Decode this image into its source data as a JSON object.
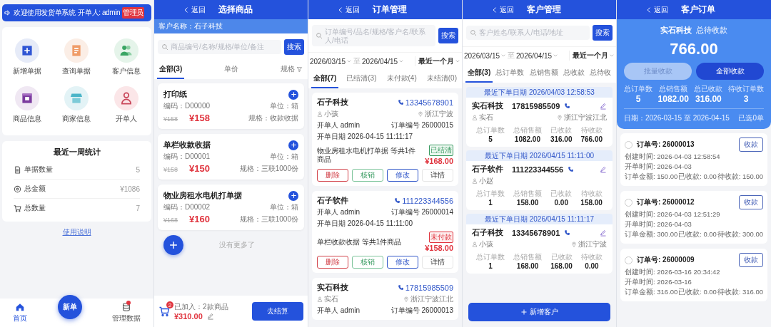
{
  "home": {
    "banner": {
      "text": "欢迎使用发货单系统",
      "operator": "开单人: admin",
      "role": "管理员"
    },
    "shortcuts": [
      {
        "kind": "add",
        "label": "新增单据"
      },
      {
        "kind": "query",
        "label": "查询单据"
      },
      {
        "kind": "customer",
        "label": "客户信息"
      },
      {
        "kind": "goods",
        "label": "商品信息"
      },
      {
        "kind": "merchant",
        "label": "商家信息"
      },
      {
        "kind": "operator",
        "label": "开单人"
      }
    ],
    "stats": {
      "title": "最近一周统计",
      "rows": [
        {
          "kind": "doc",
          "label": "单据数量",
          "value": "5"
        },
        {
          "kind": "coin",
          "label": "总金额",
          "value": "¥1086"
        },
        {
          "kind": "cart",
          "label": "总数量",
          "value": "7"
        }
      ]
    },
    "help_link": "使用说明",
    "tabbar": {
      "items": [
        {
          "kind": "home",
          "label": "首页",
          "selected": true,
          "badge": false
        },
        {
          "kind": "data",
          "label": "管理数据",
          "selected": false,
          "badge": true
        }
      ],
      "new_button": "新单"
    }
  },
  "select_goods": {
    "header": {
      "back": "返回",
      "title": "选择商品"
    },
    "customer": "客户名称：石子科技",
    "search": {
      "placeholder": "商品编号/名称/规格/单位/备注",
      "button": "搜索"
    },
    "tabs": [
      {
        "label": "全部(3)",
        "selected": true,
        "filter": false
      },
      {
        "label": "单价",
        "selected": false,
        "filter": false
      },
      {
        "label": "规格",
        "selected": false,
        "filter": true
      }
    ],
    "goods": [
      {
        "name": "打印纸",
        "code": "编码：D00000",
        "unit": "单位：箱",
        "old_price": "¥158",
        "price": "¥158",
        "spec": "规格：收款收据"
      },
      {
        "name": "单栏收款收据",
        "code": "编码：D00001",
        "unit": "单位：箱",
        "old_price": "¥158",
        "price": "¥150",
        "spec": "规格：三联1000份"
      },
      {
        "name": "物业房租水电机打单据",
        "code": "编码：D00002",
        "unit": "单位：箱",
        "old_price": "¥168",
        "price": "¥160",
        "spec": "规格：三联1000份"
      }
    ],
    "no_more": "没有更多了",
    "cart": {
      "count": "2",
      "added": "已加入：2款商品",
      "total": "¥310.00",
      "checkout": "去结算"
    }
  },
  "orders": {
    "header": {
      "back": "返回",
      "title": "订单管理"
    },
    "search": {
      "placeholder": "订单编号/品名/规格/客户名/联系人/电话",
      "button": "搜索"
    },
    "dates": {
      "from": "2026/03/15",
      "sep": "至",
      "to": "2026/04/15",
      "range": "最近一个月"
    },
    "tabs": [
      {
        "label": "全部(7)",
        "selected": true
      },
      {
        "label": "已结清(3)",
        "selected": false
      },
      {
        "label": "未付款(4)",
        "selected": false
      },
      {
        "label": "未结清(0)",
        "selected": false
      }
    ],
    "list": [
      {
        "customer": "石子科技",
        "phone": "13345678901",
        "contact": "小孩",
        "region": "浙江宁波",
        "operator": "开单人 admin",
        "order_no": "订单编号 26000015",
        "date": "开单日期 2026-04-15 11:11:17",
        "summary": "物业房租水电机打单据 等共1件商品",
        "status": {
          "label": "已结清",
          "kind": "paid"
        },
        "amount": "¥168.00",
        "actions": [
          {
            "label": "删除",
            "kind": "delete"
          },
          {
            "label": "核销",
            "kind": "verify"
          },
          {
            "label": "修改",
            "kind": "edit"
          },
          {
            "label": "详情",
            "kind": "detail"
          }
        ]
      },
      {
        "customer": "石子软件",
        "phone": "111223344556",
        "operator": "开单人 admin",
        "order_no": "订单编号 26000014",
        "date": "开单日期 2026-04-15 11:11:00",
        "summary": "单栏收款收据 等共1件商品",
        "status": {
          "label": "未付款",
          "kind": "unpaid"
        },
        "amount": "¥158.00",
        "actions": [
          {
            "label": "删除",
            "kind": "delete"
          },
          {
            "label": "核销",
            "kind": "verify"
          },
          {
            "label": "修改",
            "kind": "edit"
          },
          {
            "label": "详情",
            "kind": "detail"
          }
        ]
      },
      {
        "customer": "实石科技",
        "phone": "17815985509",
        "contact": "实石",
        "region": "浙江宁波江北",
        "operator": "开单人 admin",
        "order_no": "订单编号 26000013"
      }
    ]
  },
  "customers": {
    "header": {
      "back": "返回",
      "title": "客户管理"
    },
    "search": {
      "placeholder": "客户姓名/联系人/电话/地址",
      "button": "搜索"
    },
    "dates": {
      "from": "2026/03/15",
      "sep": "至",
      "to": "2026/04/15",
      "range": "最近一个月"
    },
    "tabs": [
      {
        "label": "全部(3)",
        "selected": true
      },
      {
        "label": "总订单数",
        "selected": false
      },
      {
        "label": "总销售额",
        "selected": false
      },
      {
        "label": "总收款",
        "selected": false
      },
      {
        "label": "总待收",
        "selected": false
      }
    ],
    "list": [
      {
        "last_order": "最近下单日期 2026/04/03 12:58:53",
        "name": "实石科技",
        "phone": "17815985509",
        "contact": "实石",
        "region": "浙江宁波江北",
        "stats": [
          {
            "label": "总订单数",
            "value": "5"
          },
          {
            "label": "总销售额",
            "value": "1082.00"
          },
          {
            "label": "已收款",
            "value": "316.00"
          },
          {
            "label": "待收款",
            "value": "766.00"
          }
        ]
      },
      {
        "last_order": "最近下单日期 2026/04/15 11:11:00",
        "name": "石子软件",
        "phone": "111223344556",
        "contact": "小赵",
        "stats": [
          {
            "label": "总订单数",
            "value": "1"
          },
          {
            "label": "总销售额",
            "value": "158.00"
          },
          {
            "label": "已收款",
            "value": "0.00"
          },
          {
            "label": "待收款",
            "value": "158.00"
          }
        ]
      },
      {
        "last_order": "最近下单日期 2026/04/15 11:11:17",
        "name": "石子科技",
        "phone": "13345678901",
        "contact": "小孩",
        "region": "浙江宁波",
        "stats": [
          {
            "label": "总订单数",
            "value": "1"
          },
          {
            "label": "总销售额",
            "value": "168.00"
          },
          {
            "label": "已收款",
            "value": "168.00"
          },
          {
            "label": "待收款",
            "value": "0.00"
          }
        ]
      }
    ],
    "add_button": "新增客户"
  },
  "customer_orders": {
    "header": {
      "back": "返回",
      "title": "客户订单"
    },
    "customer": "实石科技",
    "due_label": "总待收款",
    "due": "766.00",
    "batch": {
      "label": "批量收款",
      "disabled": true
    },
    "collect_all": "全部收款",
    "stats": [
      {
        "label": "总订单数",
        "value": "5"
      },
      {
        "label": "总销售额",
        "value": "1082.00"
      },
      {
        "label": "总已收款",
        "value": "316.00"
      },
      {
        "label": "待收订单数",
        "value": "3"
      }
    ],
    "date": "日期：2026-03-15  至  2026-04-15",
    "selected_count": "已选0单",
    "list": [
      {
        "checked": false,
        "order_no": "订单号: 26000013",
        "created": "创建时间: 2026-04-03 12:58:54",
        "opened": "开单时间: 2026-04-03",
        "amount": "订单金额: 150.00",
        "paid": "已收款: 0.00",
        "due": "待收款: 150.00",
        "button": "收款"
      },
      {
        "checked": false,
        "order_no": "订单号: 26000012",
        "created": "创建时间: 2026-04-03 12:51:29",
        "opened": "开单时间: 2026-04-03",
        "amount": "订单金额: 300.00",
        "paid": "已收款: 0.00",
        "due": "待收款: 300.00",
        "button": "收款"
      },
      {
        "checked": false,
        "order_no": "订单号: 26000009",
        "created": "创建时间: 2026-03-16 20:34:42",
        "opened": "开单时间: 2026-03-16",
        "amount": "订单金额: 316.00",
        "paid": "已收款: 0.00",
        "due": "待收款: 316.00",
        "button": "收款"
      }
    ]
  }
}
